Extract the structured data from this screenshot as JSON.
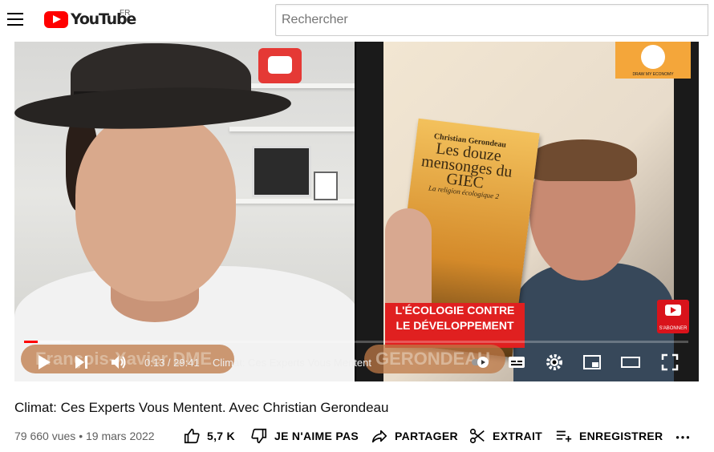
{
  "header": {
    "logo_text": "YouTube",
    "region": "FR",
    "search_placeholder": "Rechercher"
  },
  "player": {
    "time_display": "0:13 / 29:41",
    "chapter_title": "Climat: Ces Experts Vous Mentent",
    "progress_fraction": 0.0073,
    "overlay_left_name": "François-Xavier DME",
    "overlay_right_name": "GERONDEAU",
    "book": {
      "author": "Christian Gerondeau",
      "title": "Les douze mensonges du GIEC",
      "subtitle": "La religion écologique 2",
      "banner_line1": "L'ÉCOLOGIE CONTRE",
      "banner_line2": "LE DÉVELOPPEMENT"
    },
    "channel_card_caption": "DRAW MY ECONOMY",
    "subscribe_badge": "S'ABONNER"
  },
  "video": {
    "title": "Climat: Ces Experts Vous Mentent. Avec Christian Gerondeau",
    "views": "79 660 vues",
    "separator": "•",
    "date": "19 mars 2022"
  },
  "actions": {
    "like": "5,7 K",
    "dislike": "JE N'AIME PAS",
    "share": "PARTAGER",
    "clip": "EXTRAIT",
    "save": "ENREGISTRER"
  },
  "colors": {
    "brand_red": "#ff0000",
    "text_primary": "#0f0f0f",
    "text_secondary": "#606060"
  }
}
